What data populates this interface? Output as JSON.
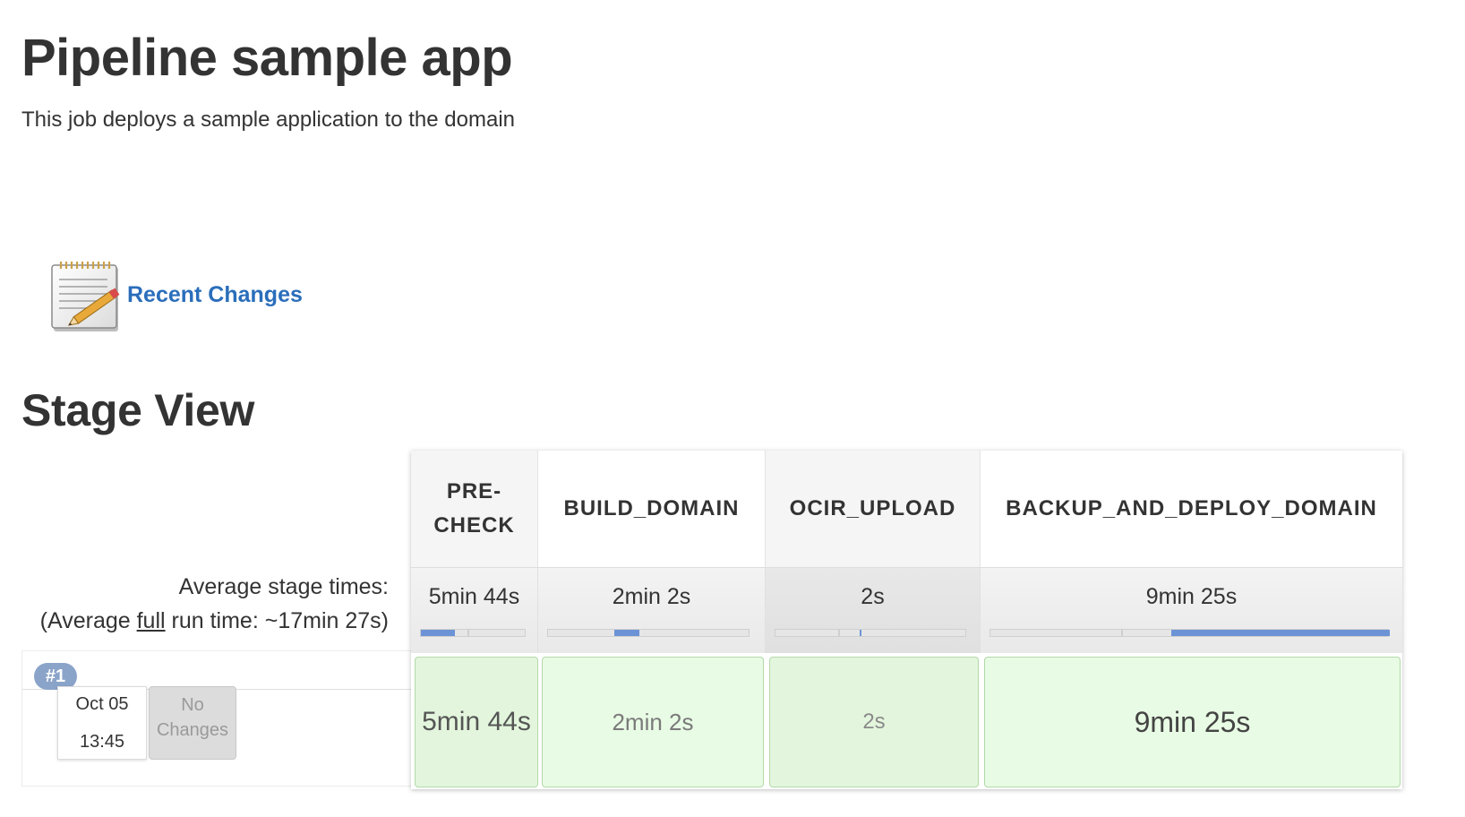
{
  "page": {
    "title": "Pipeline sample app",
    "description": "This job deploys a sample application to the domain"
  },
  "recent_changes": {
    "icon": "notepad-icon",
    "label": "Recent Changes"
  },
  "stage_view": {
    "title": "Stage View",
    "average_label": "Average stage times:",
    "average_full_prefix": "(Average ",
    "average_full_word": "full",
    "average_full_suffix": " run time: ~17min 27s)",
    "stages": [
      {
        "name_line1": "PRE-",
        "name_line2": "CHECK",
        "avg_time": "5min 44s",
        "run_time": "5min 44s"
      },
      {
        "name_line1": "BUILD_DOMAIN",
        "name_line2": "",
        "avg_time": "2min 2s",
        "run_time": "2min 2s"
      },
      {
        "name_line1": "OCIR_UPLOAD",
        "name_line2": "",
        "avg_time": "2s",
        "run_time": "2s"
      },
      {
        "name_line1": "BACKUP_AND_DEPLOY_DOMAIN",
        "name_line2": "",
        "avg_time": "9min 25s",
        "run_time": "9min 25s"
      }
    ],
    "runs": [
      {
        "id": "#1",
        "date": "Oct 05",
        "time": "13:45",
        "changes_line1": "No",
        "changes_line2": "Changes"
      }
    ],
    "colors": {
      "success_cell": "#e3f6dd",
      "bar_fill": "#6b93d6",
      "link": "#2a6ebb",
      "badge": "#8aa3c9"
    }
  }
}
